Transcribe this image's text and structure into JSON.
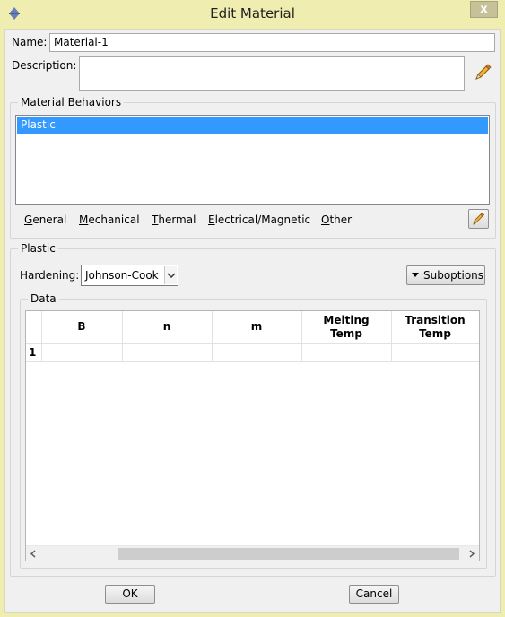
{
  "window": {
    "title": "Edit Material",
    "close_glyph": "x"
  },
  "name_field": {
    "label": "Name:",
    "value": "Material-1"
  },
  "description_field": {
    "label": "Description:",
    "value": ""
  },
  "behaviors": {
    "legend": "Material Behaviors",
    "items": [
      {
        "label": "Plastic",
        "selected": true
      }
    ]
  },
  "menu": [
    {
      "label": "General",
      "underline": "G",
      "rest": "eneral"
    },
    {
      "label": "Mechanical",
      "underline": "M",
      "rest": "echanical"
    },
    {
      "label": "Thermal",
      "underline": "T",
      "rest": "hermal"
    },
    {
      "label": "Electrical/Magnetic",
      "underline": "E",
      "rest": "lectrical/Magnetic"
    },
    {
      "label": "Other",
      "underline": "O",
      "rest": "ther"
    }
  ],
  "plastic": {
    "legend": "Plastic",
    "hardening_label": "Hardening:",
    "hardening_value": "Johnson-Cook",
    "suboptions_label": "Suboptions"
  },
  "data_table": {
    "legend": "Data",
    "headers": [
      {
        "line1": "B",
        "line2": ""
      },
      {
        "line1": "n",
        "line2": ""
      },
      {
        "line1": "m",
        "line2": ""
      },
      {
        "line1": "Melting",
        "line2": "Temp"
      },
      {
        "line1": "Transition",
        "line2": "Temp"
      }
    ],
    "rows": [
      {
        "index": "1",
        "cells": [
          "",
          "",
          "",
          "",
          ""
        ]
      }
    ]
  },
  "buttons": {
    "ok": "OK",
    "cancel": "Cancel"
  },
  "colors": {
    "selection": "#3399ff",
    "title_bar": "#efeeb0"
  }
}
